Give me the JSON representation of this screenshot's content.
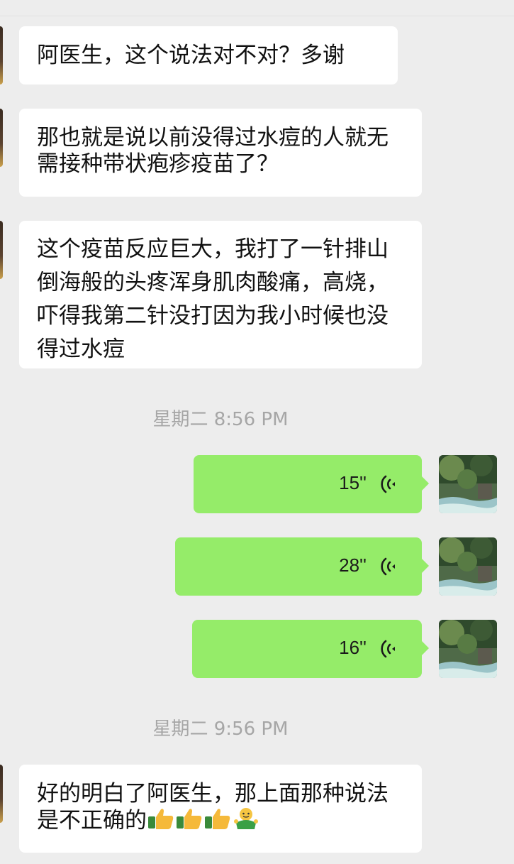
{
  "messages_in": [
    {
      "text": "阿医生，这个说法对不对？多谢"
    },
    {
      "text": "那也就是说以前没得过水痘的人就无需接种带状疱疹疫苗了？"
    },
    {
      "text": "这个疫苗反应巨大，我打了一针排山倒海般的头疼浑身肌肉酸痛，高烧，吓得我第二针没打因为我小时候也没得过水痘"
    },
    {
      "text": "好的明白了阿医生，那上面那种说法是不正确的",
      "emojis": [
        "thumbs-up",
        "thumbs-up",
        "thumbs-up",
        "shrug"
      ]
    }
  ],
  "timestamps": [
    "星期二 8:56 PM",
    "星期二 9:56 PM"
  ],
  "voice_messages": [
    {
      "duration": "15''"
    },
    {
      "duration": "28''"
    },
    {
      "duration": "16''"
    }
  ],
  "colors": {
    "background": "#ededed",
    "incoming_bubble": "#ffffff",
    "outgoing_bubble": "#95ec69",
    "timestamp_text": "#a6a6a6"
  },
  "icons": {
    "voice": "voice-wave-icon",
    "thumbs_up": "thumbs-up-icon",
    "shrug": "shrug-emoji-icon"
  }
}
